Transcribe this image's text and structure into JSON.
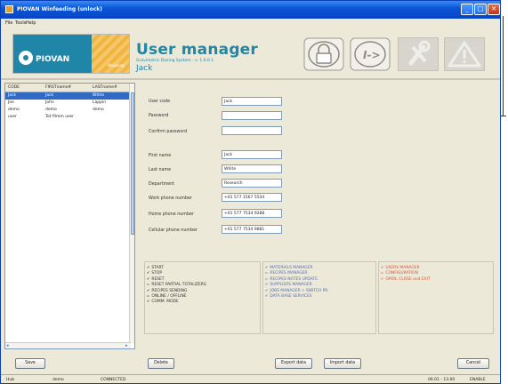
{
  "window": {
    "title": "PIOVAN Winfeeding (unlock)"
  },
  "menu": [
    "File",
    "Tools",
    "Help"
  ],
  "header": {
    "brand": "PIOVAN",
    "brand_sub": "Weighing",
    "title": "User manager",
    "subtitle": "Gravimetric Dosing System - v. 1.0.0.1",
    "current_user": "Jack",
    "icons": [
      "padlock-icon",
      "log-in-icon",
      "tools-icon",
      "warning-icon"
    ]
  },
  "user_table": {
    "columns": [
      "CODE",
      "FIRSTname#",
      "LASTname#"
    ],
    "rows": [
      {
        "code": "Jack",
        "first": "Jack",
        "last": "White",
        "selected": true
      },
      {
        "code": "Joe",
        "first": "John",
        "last": "Lappin",
        "selected": false
      },
      {
        "code": "demo",
        "first": "demo",
        "last": "demo",
        "selected": false
      },
      {
        "code": "user",
        "first": "Tot filmm user",
        "last": "",
        "selected": false
      }
    ]
  },
  "form": {
    "user_code": {
      "label": "User code",
      "value": "Jack"
    },
    "password": {
      "label": "Password",
      "value": ""
    },
    "confirm_password": {
      "label": "Confirm password",
      "value": ""
    },
    "first_name": {
      "label": "First name",
      "value": "Jack"
    },
    "last_name": {
      "label": "Last name",
      "value": "White"
    },
    "department": {
      "label": "Department",
      "value": "Research"
    },
    "work_phone": {
      "label": "Work phone number",
      "value": "+01 577 1567 5534"
    },
    "home_phone": {
      "label": "Home phone number",
      "value": "+01 577 7534 9288"
    },
    "cell_phone": {
      "label": "Cellular phone number",
      "value": "+01 577 7534 9881"
    }
  },
  "permissions": {
    "group1": [
      {
        "label": "START",
        "checked": true
      },
      {
        "label": "STOP",
        "checked": true
      },
      {
        "label": "RESET",
        "checked": true
      },
      {
        "label": "RESET PARTIAL TOTALIZERS",
        "checked": false
      },
      {
        "label": "RECIPES SENDING",
        "checked": true
      },
      {
        "label": "ONLINE / OFFLINE",
        "checked": false
      },
      {
        "label": "COMM. MODE",
        "checked": true
      }
    ],
    "group2": [
      {
        "label": "MATERIALS MANAGER",
        "checked": true
      },
      {
        "label": "RECIPES MANAGER",
        "checked": false
      },
      {
        "label": "RECIPES NOTES UPDATE",
        "checked": false
      },
      {
        "label": "SUPPLIERS MANAGER",
        "checked": true
      },
      {
        "label": "JOBS MANAGER + SWITCH PR.",
        "checked": true
      },
      {
        "label": "DATA BASE SERVICES",
        "checked": true
      }
    ],
    "group3": [
      {
        "label": "USERS MANAGER",
        "checked": true
      },
      {
        "label": "CONFIGURATION",
        "checked": false
      },
      {
        "label": "OPEN, CLOSE and EXIT",
        "checked": true
      }
    ],
    "colors": {
      "group1": "#333333",
      "group2": "#5a6fb0",
      "group3": "#d05a3a"
    }
  },
  "buttons": {
    "save": "Save",
    "delete": "Delete",
    "export": "Export data",
    "import": "Import data",
    "cancel": "Cancel"
  },
  "statusbar": {
    "mode": "Hub",
    "user": "demo",
    "connection": "CONNECTED",
    "time": "06.01 - 13.00",
    "lock": "ENABLE"
  }
}
